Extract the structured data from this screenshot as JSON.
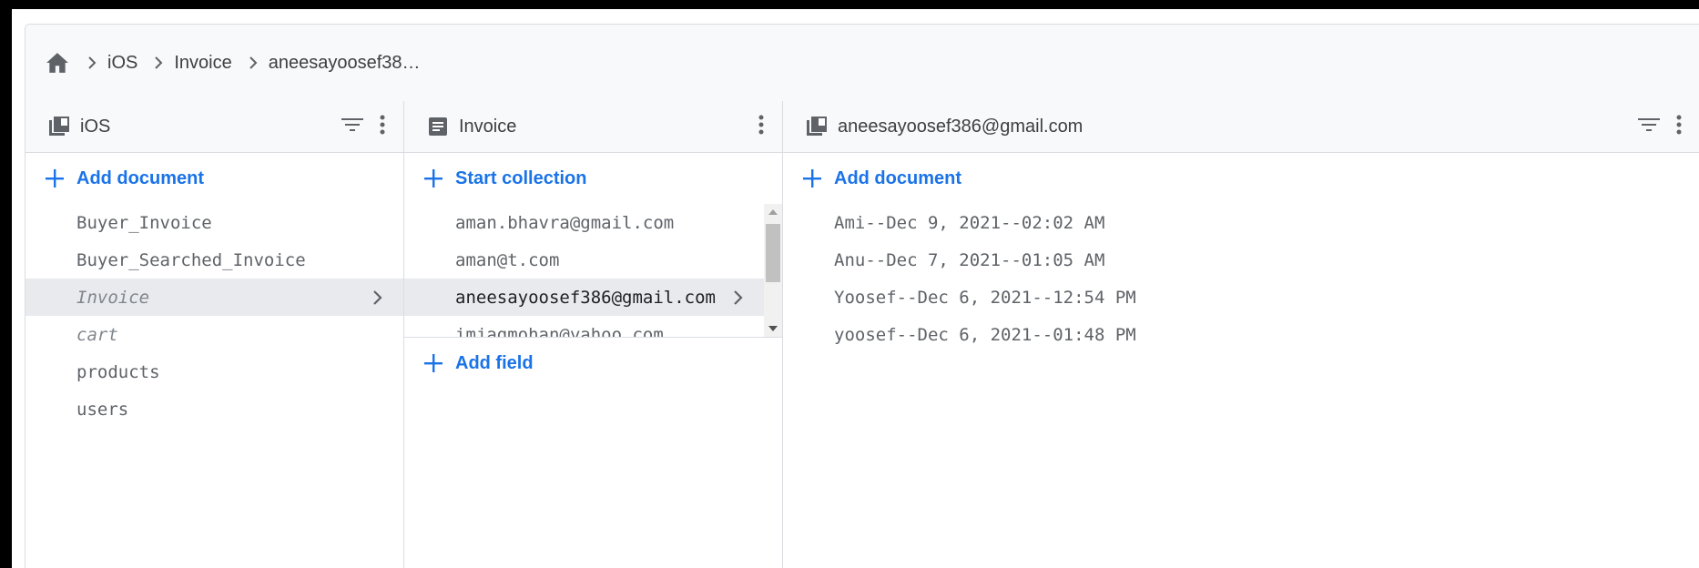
{
  "breadcrumb": {
    "items": [
      "iOS",
      "Invoice",
      "aneesayoosef38…"
    ]
  },
  "columns": [
    {
      "title": "iOS",
      "add_label": "Add document",
      "items": [
        "Buyer_Invoice",
        "Buyer_Searched_Invoice",
        "Invoice",
        "cart",
        "products",
        "users"
      ]
    },
    {
      "title": "Invoice",
      "add_label": "Start collection",
      "items": [
        "aman.bhavra@gmail.com",
        "aman@t.com",
        "aneesayoosef386@gmail.com",
        "imjagmohan@yahoo.com"
      ],
      "add_field_label": "Add field"
    },
    {
      "title": "aneesayoosef386@gmail.com",
      "add_label": "Add document",
      "items": [
        "Ami--Dec 9, 2021--02:02 AM",
        "Anu--Dec 7, 2021--01:05 AM",
        "Yoosef--Dec 6, 2021--12:54 PM",
        "yoosef--Dec 6, 2021--01:48 PM"
      ]
    }
  ],
  "colors": {
    "accent": "#1a73e8",
    "selected_bg": "#e8eaed",
    "header_bg": "#f8f9fa"
  },
  "icons": [
    "home-icon",
    "chevron-right-icon",
    "collection-icon",
    "document-icon",
    "filter-icon",
    "more-vert-icon",
    "plus-icon"
  ]
}
